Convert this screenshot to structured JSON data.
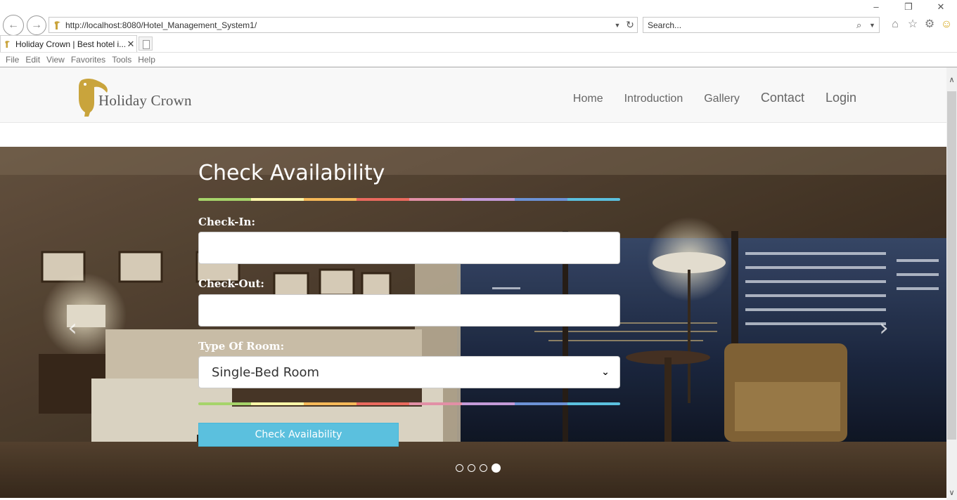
{
  "browser": {
    "address_url": "http://localhost:8080/Hotel_Management_System1/",
    "search_placeholder": "Search...",
    "tab_title": "Holiday Crown | Best hotel i...",
    "menu": [
      "File",
      "Edit",
      "View",
      "Favorites",
      "Tools",
      "Help"
    ]
  },
  "site": {
    "brand": "Holiday Crown",
    "nav": [
      "Home",
      "Introduction",
      "Gallery",
      "Contact",
      "Login"
    ]
  },
  "form": {
    "title": "Check Availability",
    "checkin_label": "Check-In:",
    "checkin_value": "",
    "checkout_label": "Check-Out:",
    "checkout_value": "",
    "room_label": "Type Of Room:",
    "room_value": "Single-Bed Room",
    "submit_label": "Check Availability",
    "rainbow_colors": [
      "#a6d46a",
      "#fbf6a8",
      "#f6b958",
      "#ea6a5e",
      "#e28fa6",
      "#c49ad8",
      "#6c92d6",
      "#5bc0de"
    ]
  },
  "carousel": {
    "slide_count": 4,
    "active_index": 3
  },
  "colors": {
    "accent": "#5bc0de",
    "logo_gold": "#c9a43c"
  },
  "icons": [
    "back-icon",
    "forward-icon",
    "refresh-icon",
    "search-icon",
    "home-icon",
    "favorites-star-icon",
    "settings-gear-icon",
    "smiley-feedback-icon"
  ]
}
